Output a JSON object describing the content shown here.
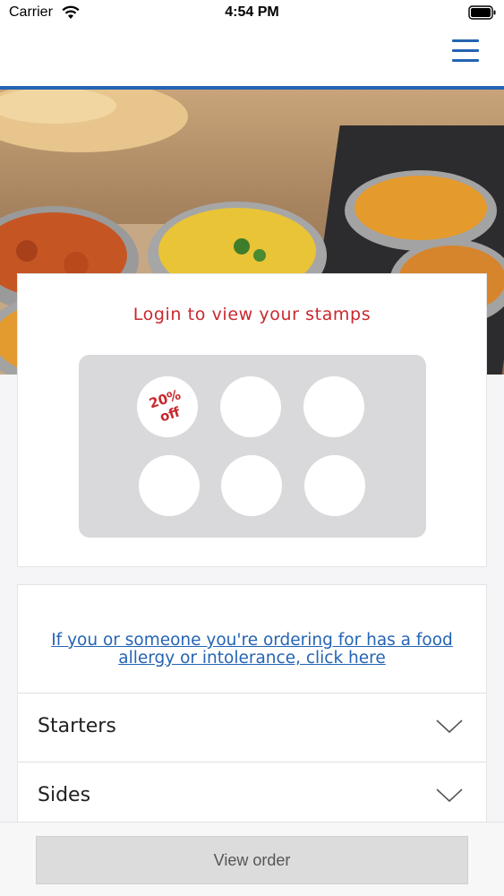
{
  "status_bar": {
    "carrier": "Carrier",
    "time": "4:54 PM",
    "wifi_icon": "wifi-icon",
    "battery_icon": "battery-icon"
  },
  "nav": {
    "menu_icon": "hamburger-menu-icon",
    "accent_color": "#2464b4"
  },
  "hero": {
    "image": "indian-food-dishes-photo"
  },
  "stamps": {
    "login_prompt": "Login to view your stamps",
    "reward_line1": "20%",
    "reward_line2": "off",
    "stamp_count": 6,
    "reward_color": "#c8282d"
  },
  "allergy": {
    "link_text": "If you or someone you're ordering for has a food allergy or intolerance, click here"
  },
  "menu": {
    "categories": [
      {
        "label": "Starters",
        "icon": "chevron-down-icon"
      },
      {
        "label": "Sides",
        "icon": "chevron-down-icon"
      }
    ]
  },
  "footer": {
    "view_order_label": "View order"
  }
}
